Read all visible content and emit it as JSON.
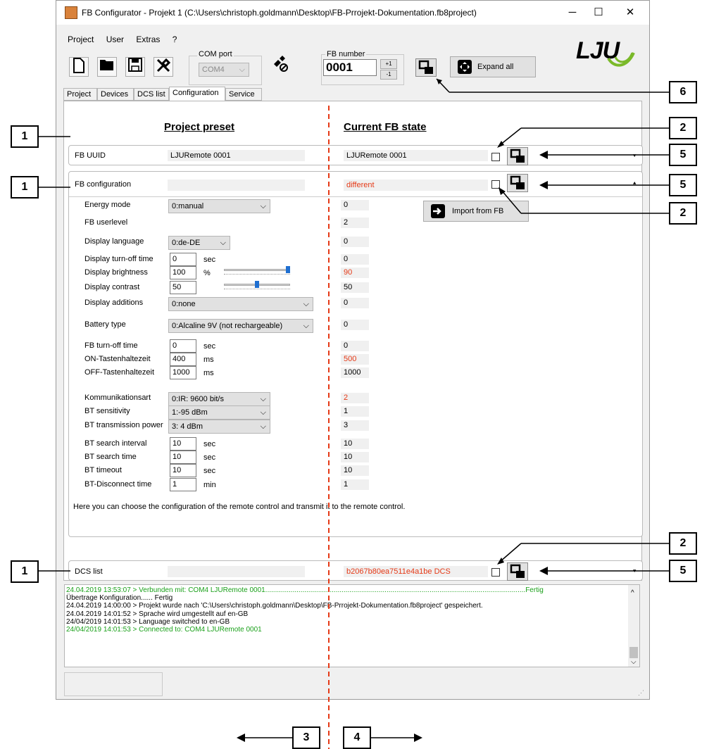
{
  "window": {
    "title": "FB Configurator - Projekt 1 (C:\\Users\\christoph.goldmann\\Desktop\\FB-Prrojekt-Dokumentation.fb8project)",
    "min": "─",
    "max": "☐",
    "close": "✕"
  },
  "menu": [
    "Project",
    "User",
    "Extras",
    "?"
  ],
  "toolbar": {
    "com_port_label": "COM port",
    "com_port_value": "COM4",
    "fb_number_label": "FB number",
    "fb_number_value": "0001",
    "plus": "+1",
    "minus": "-1",
    "expand_all": "Expand all",
    "logo": "LJU"
  },
  "tabs": [
    "Project",
    "Devices",
    "DCS list",
    "Configuration",
    "Service"
  ],
  "headings": {
    "preset": "Project preset",
    "current": "Current FB state"
  },
  "rows": {
    "uuid": {
      "label": "FB UUID",
      "preset": "LJURemote 0001",
      "current": "LJURemote 0001"
    },
    "config": {
      "label": "FB configuration",
      "preset": "",
      "current": "different"
    },
    "dcs": {
      "label": "DCS list",
      "preset": "",
      "current": "b2067b80ea7511e4a1be DCS"
    }
  },
  "import_button": "Import from FB",
  "settings": [
    {
      "label": "Energy mode",
      "value": "0:manual",
      "current": "0",
      "diff": false
    },
    {
      "label": "FB userlevel",
      "value": "",
      "current": "2",
      "diff": false
    },
    {
      "label": "Display language",
      "value": "0:de-DE",
      "current": "0",
      "diff": false
    },
    {
      "label": "Display turn-off time",
      "value": "0",
      "unit": "sec",
      "current": "0",
      "diff": false
    },
    {
      "label": "Display brightness",
      "value": "100",
      "unit": "%",
      "current": "90",
      "diff": true
    },
    {
      "label": "Display contrast",
      "value": "50",
      "current": "50",
      "diff": false
    },
    {
      "label": "Display additions",
      "value": "0:none",
      "current": "0",
      "diff": false
    },
    {
      "label": "Battery type",
      "value": "0:Alcaline 9V (not rechargeable)",
      "current": "0",
      "diff": false
    },
    {
      "label": "FB turn-off time",
      "value": "0",
      "unit": "sec",
      "current": "0",
      "diff": false
    },
    {
      "label": "ON-Tastenhaltezeit",
      "value": "400",
      "unit": "ms",
      "current": "500",
      "diff": true
    },
    {
      "label": "OFF-Tastenhaltezeit",
      "value": "1000",
      "unit": "ms",
      "current": "1000",
      "diff": false
    },
    {
      "label": "Kommunikationsart",
      "value": "0:IR: 9600 bit/s",
      "current": "2",
      "diff": true
    },
    {
      "label": "BT sensitivity",
      "value": "1:-95 dBm",
      "current": "1",
      "diff": false
    },
    {
      "label": "BT transmission power",
      "value": "3: 4 dBm",
      "current": "3",
      "diff": false
    },
    {
      "label": "BT search interval",
      "value": "10",
      "unit": "sec",
      "current": "10",
      "diff": false
    },
    {
      "label": "BT search time",
      "value": "10",
      "unit": "sec",
      "current": "10",
      "diff": false
    },
    {
      "label": "BT timeout",
      "value": "10",
      "unit": "sec",
      "current": "10",
      "diff": false
    },
    {
      "label": "BT-Disconnect time",
      "value": "1",
      "unit": "min",
      "current": "1",
      "diff": false
    }
  ],
  "sliders": {
    "brightness": 1.0,
    "contrast": 0.5
  },
  "hint": "Here you can choose the configuration of the remote control and transmit it to the remote control.",
  "log": [
    {
      "text": "24.04.2019 13:53:07 > Verbunden mit: COM4 LJURemote 0001.....................................................................................................................................Fertig",
      "color": "green"
    },
    {
      "text": "Übertrage Konfiguration...... Fertig",
      "color": "black"
    },
    {
      "text": "24.04.2019 14:00:00 > Projekt wurde nach 'C:\\Users\\christoph.goldmann\\Desktop\\FB-Prrojekt-Dokumentation.fb8project' gespeichert.",
      "color": "black"
    },
    {
      "text": "24.04.2019 14:01:52 > Sprache wird umgestellt auf en-GB",
      "color": "black"
    },
    {
      "text": "24/04/2019 14:01:53 > Language switched to en-GB",
      "color": "black"
    },
    {
      "text": "24/04/2019 14:01:53 > Connected to: COM4 LJURemote 0001",
      "color": "green"
    }
  ],
  "callouts": [
    "1",
    "1",
    "1",
    "2",
    "2",
    "2",
    "3",
    "4",
    "5",
    "5",
    "5",
    "6"
  ],
  "colors": {
    "accent_red": "#e53916",
    "log_green": "#1aa01a",
    "logo_green": "#7ab929"
  }
}
